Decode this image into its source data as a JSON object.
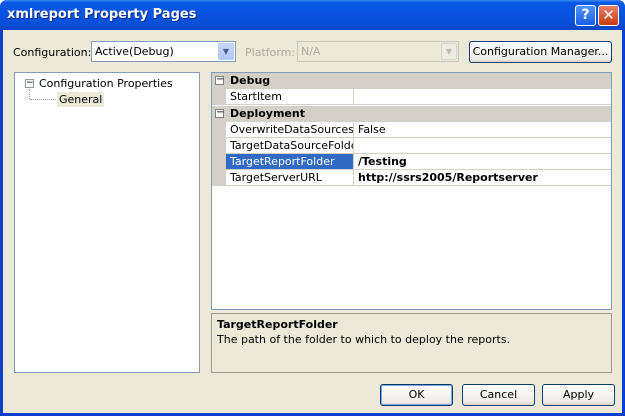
{
  "window": {
    "title": "xmlreport Property Pages"
  },
  "titlebar": {
    "help_glyph": "?",
    "close_glyph": "✕"
  },
  "config": {
    "configuration_label": "Configuration:",
    "configuration_value": "Active(Debug)",
    "platform_label": "Platform:",
    "platform_value": "N/A",
    "manager_button": "Configuration Manager..."
  },
  "tree": {
    "root_label": "Configuration Properties",
    "root_toggle": "−",
    "child_label": "General"
  },
  "grid": {
    "categories": [
      {
        "label": "Debug",
        "toggle": "−"
      },
      {
        "label": "Deployment",
        "toggle": "−"
      }
    ],
    "debug_rows": [
      {
        "name": "StartItem",
        "value": ""
      }
    ],
    "deployment_rows": [
      {
        "name": "OverwriteDataSources",
        "value": "False"
      },
      {
        "name": "TargetDataSourceFolder",
        "value": ""
      },
      {
        "name": "TargetReportFolder",
        "value": "/Testing"
      },
      {
        "name": "TargetServerURL",
        "value": "http://ssrs2005/Reportserver"
      }
    ]
  },
  "description": {
    "title": "TargetReportFolder",
    "text": "The path of the folder to which to deploy the reports."
  },
  "buttons": {
    "ok": "OK",
    "cancel": "Cancel",
    "apply": "Apply"
  },
  "colors": {
    "selection": "#316ac5",
    "title_bar": "#0854e0",
    "dialog_face": "#ece9d8"
  }
}
